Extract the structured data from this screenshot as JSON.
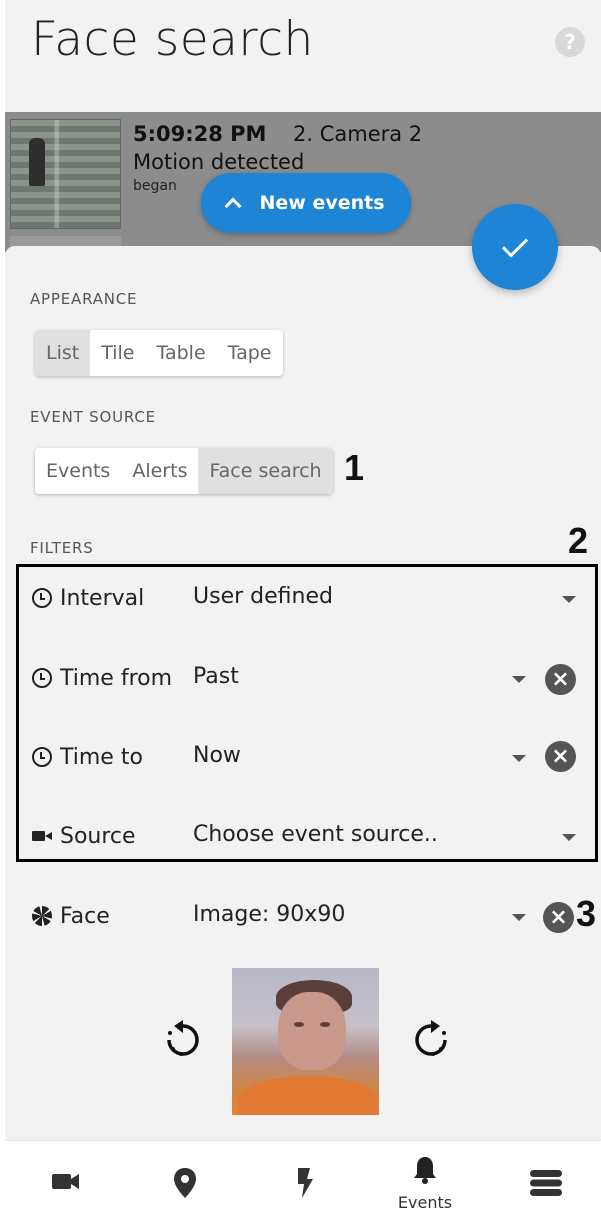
{
  "header": {
    "title": "Face search",
    "help_glyph": "?"
  },
  "event_card": {
    "time": "5:09:28 PM",
    "camera": "2. Camera 2",
    "type": "Motion detected",
    "sub": "began"
  },
  "new_events": {
    "label": "New events"
  },
  "appearance": {
    "label": "APPEARANCE",
    "options": [
      "List",
      "Tile",
      "Table",
      "Tape"
    ],
    "selected": "List"
  },
  "event_source": {
    "label": "EVENT SOURCE",
    "options": [
      "Events",
      "Alerts",
      "Face search"
    ],
    "selected": "Face search"
  },
  "filters": {
    "label": "FILTERS",
    "interval": {
      "label": "Interval",
      "value": "User defined",
      "icon": "clock-icon"
    },
    "time_from": {
      "label": "Time from",
      "value": "Past",
      "icon": "clock-icon"
    },
    "time_to": {
      "label": "Time to",
      "value": "Now",
      "icon": "clock-icon"
    },
    "source": {
      "label": "Source",
      "value": "Choose event source..",
      "icon": "camera-icon"
    },
    "face": {
      "label": "Face",
      "value": "Image: 90x90",
      "icon": "aperture-icon"
    }
  },
  "markers": {
    "m1": "1",
    "m2": "2",
    "m3": "3"
  },
  "bottom_nav": {
    "items": [
      {
        "icon": "camera-icon",
        "label": ""
      },
      {
        "icon": "map-pin-icon",
        "label": ""
      },
      {
        "icon": "lightning-icon",
        "label": ""
      },
      {
        "icon": "bell-icon",
        "label": "Events"
      },
      {
        "icon": "server-icon",
        "label": ""
      }
    ],
    "active": "Events"
  },
  "colors": {
    "accent": "#1d84d6",
    "background": "#f2f2f2"
  }
}
